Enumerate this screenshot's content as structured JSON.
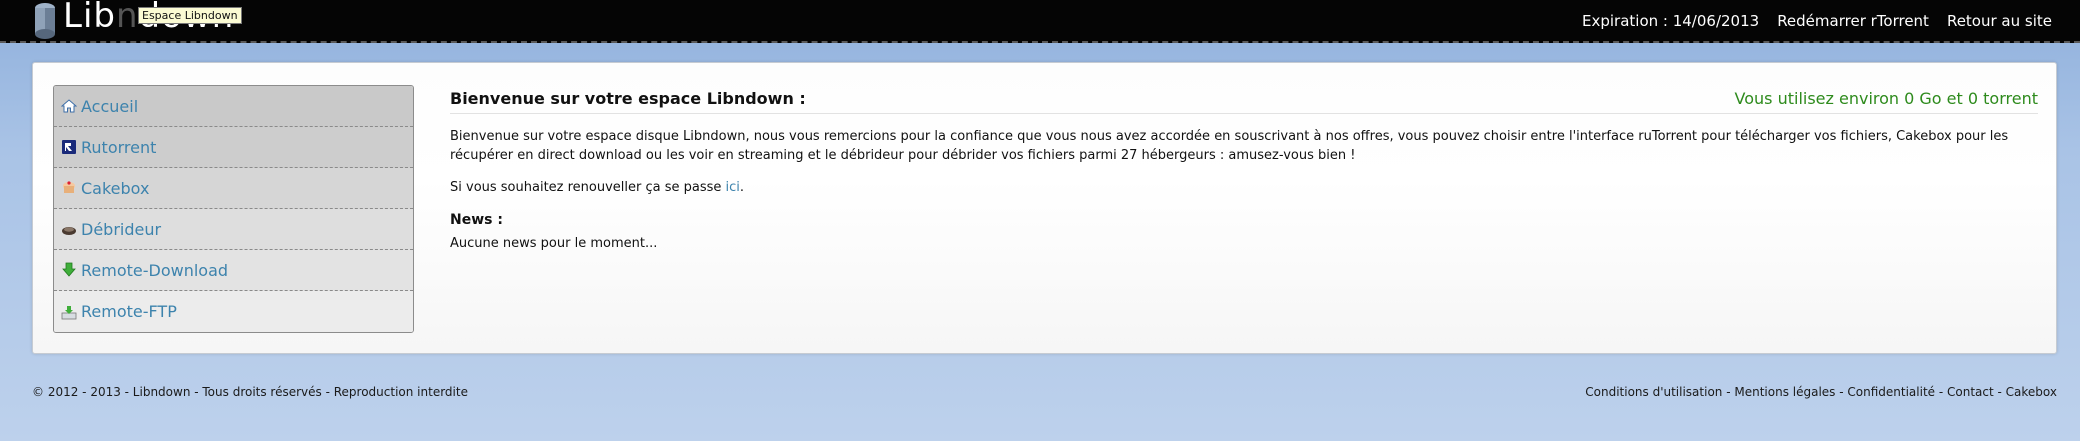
{
  "header": {
    "logo_text_start": "Lib",
    "logo_text_mid": "n",
    "logo_text_end": "down",
    "tooltip": "Espace Libndown",
    "expiration": "Expiration : 14/06/2013",
    "restart_label": "Redémarrer rTorrent",
    "back_label": "Retour au site"
  },
  "sidebar": {
    "items": [
      {
        "label": "Accueil",
        "icon": "home-icon"
      },
      {
        "label": "Rutorrent",
        "icon": "rutorrent-icon"
      },
      {
        "label": "Cakebox",
        "icon": "cake-icon"
      },
      {
        "label": "Débrideur",
        "icon": "debrideur-icon"
      },
      {
        "label": "Remote-Download",
        "icon": "download-arrow-icon"
      },
      {
        "label": "Remote-FTP",
        "icon": "ftp-upload-icon"
      }
    ]
  },
  "main": {
    "title": "Bienvenue sur votre espace Libndown :",
    "usage": "Vous utilisez environ 0 Go et 0 torrent",
    "intro": "Bienvenue sur votre espace disque Libndown, nous vous remercions pour la confiance que vous nous avez accordée en souscrivant à nos offres, vous pouvez choisir entre l'interface ruTorrent pour télécharger vos fichiers, Cakebox pour les récupérer en direct download ou les voir en streaming et le débrideur pour débrider vos fichiers parmi 27 hébergeurs : amusez-vous bien !",
    "renew_text": "Si vous souhaitez renouveller ça se passe ",
    "renew_link": "ici",
    "renew_end": ".",
    "news_title": "News :",
    "news_empty": "Aucune news pour le moment..."
  },
  "footer": {
    "copyright": "© 2012 - 2013 - Libndown - Tous droits réservés - Reproduction interdite",
    "links": [
      "Conditions d'utilisation",
      "Mentions légales",
      "Confidentialité",
      "Contact",
      "Cakebox"
    ],
    "separator": " - "
  },
  "colors": {
    "topbar": "#050505",
    "link": "#3d83ad",
    "usage_green": "#2e8b1d"
  }
}
